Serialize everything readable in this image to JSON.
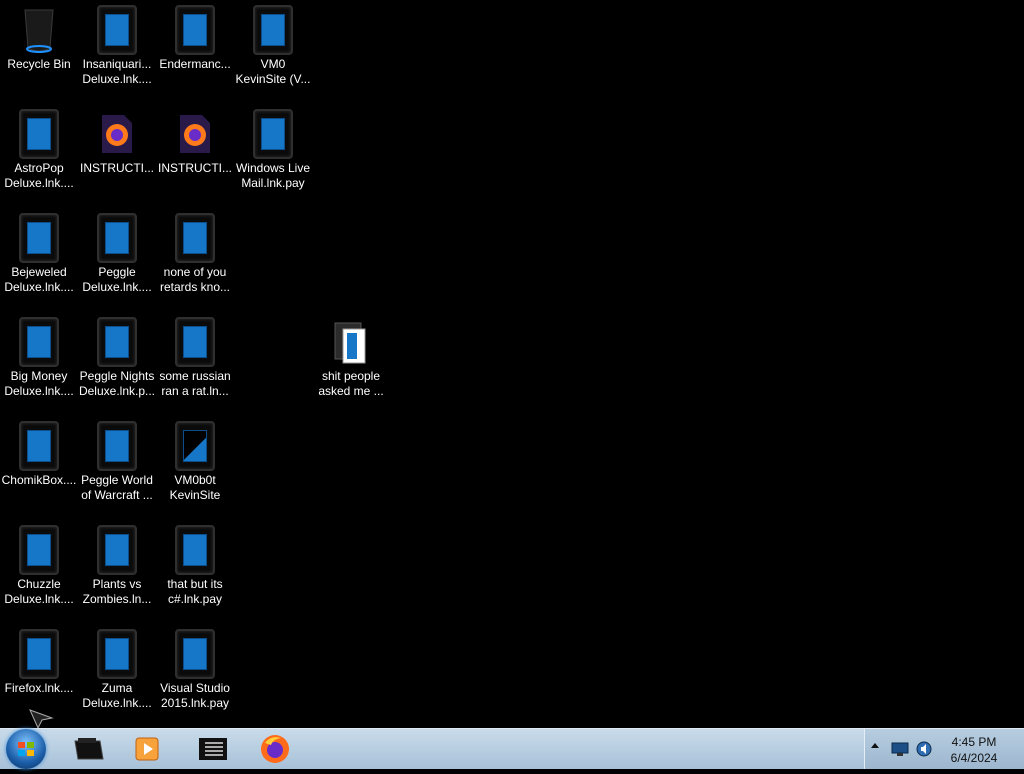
{
  "desktop_icons": [
    {
      "line1": "Recycle Bin",
      "line2": "",
      "icon": "recycle-bin-icon"
    },
    {
      "line1": "Insaniquari...",
      "line2": "Deluxe.lnk....",
      "icon": "shortcut-icon"
    },
    {
      "line1": "Endermanc...",
      "line2": "",
      "icon": "shortcut-icon"
    },
    {
      "line1": "VM0",
      "line2": "KevinSite (V...",
      "icon": "shortcut-icon"
    },
    {
      "line1": "AstroPop",
      "line2": "Deluxe.lnk....",
      "icon": "shortcut-icon"
    },
    {
      "line1": "INSTRUCTI...",
      "line2": "",
      "icon": "firefox-file-icon"
    },
    {
      "line1": "INSTRUCTI...",
      "line2": "",
      "icon": "firefox-file-icon"
    },
    {
      "line1": "Windows Live",
      "line2": "Mail.lnk.pay",
      "icon": "shortcut-icon"
    },
    {
      "line1": "Bejeweled",
      "line2": "Deluxe.lnk....",
      "icon": "shortcut-icon"
    },
    {
      "line1": "Peggle",
      "line2": "Deluxe.lnk....",
      "icon": "shortcut-icon"
    },
    {
      "line1": "none of you",
      "line2": "retards kno...",
      "icon": "shortcut-icon"
    },
    {
      "line1": "Big Money",
      "line2": "Deluxe.lnk....",
      "icon": "shortcut-icon"
    },
    {
      "line1": "Peggle Nights",
      "line2": "Deluxe.lnk.p...",
      "icon": "shortcut-icon"
    },
    {
      "line1": "some russian",
      "line2": "ran a rat.ln...",
      "icon": "shortcut-icon"
    },
    {
      "line1": "shit people",
      "line2": "asked me ...",
      "icon": "folder-icon"
    },
    {
      "line1": "ChomikBox....",
      "line2": "",
      "icon": "shortcut-icon"
    },
    {
      "line1": "Peggle World",
      "line2": "of Warcraft ...",
      "icon": "shortcut-icon"
    },
    {
      "line1": "VM0b0t",
      "line2": "KevinSite",
      "icon": "shortcut-icon"
    },
    {
      "line1": "Chuzzle",
      "line2": "Deluxe.lnk....",
      "icon": "shortcut-icon"
    },
    {
      "line1": "Plants vs",
      "line2": "Zombies.ln...",
      "icon": "shortcut-icon"
    },
    {
      "line1": "that but its",
      "line2": "c#.lnk.pay",
      "icon": "shortcut-icon"
    },
    {
      "line1": "Firefox.lnk....",
      "line2": "",
      "icon": "shortcut-icon"
    },
    {
      "line1": "Zuma",
      "line2": "Deluxe.lnk....",
      "icon": "shortcut-icon"
    },
    {
      "line1": "Visual Studio",
      "line2": "2015.lnk.pay",
      "icon": "shortcut-icon"
    }
  ],
  "taskbar": {
    "start": "start-orb-icon",
    "pinned": [
      "explorer-icon",
      "media-player-icon",
      "notepad-icon",
      "firefox-icon"
    ],
    "tray_icons": [
      "show-hidden-icon",
      "network-icon",
      "volume-icon"
    ],
    "time": "4:45 PM",
    "date": "6/4/2024"
  },
  "colors": {
    "desktop": "#000000",
    "taskbar": "#b8cfe2",
    "tile_blue": "#1677c9"
  }
}
